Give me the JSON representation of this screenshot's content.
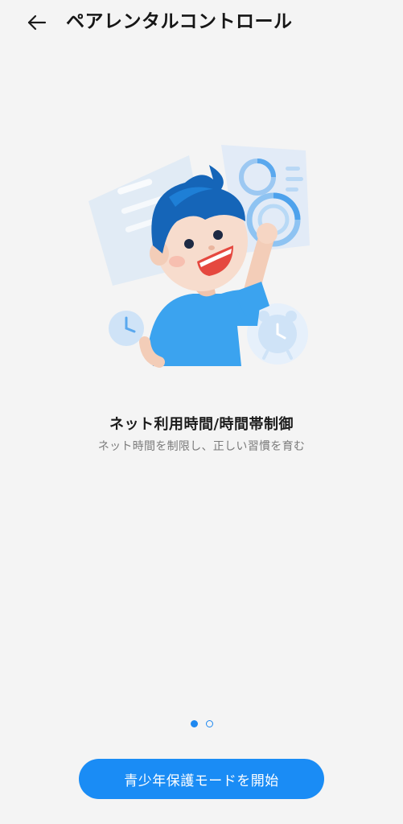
{
  "header": {
    "back_icon": "arrow-left-icon",
    "title": "ペアレンタルコントロール"
  },
  "illustration": {
    "subject": "boy-with-floating-screens",
    "icons": [
      "clock-icon",
      "alarm-clock-icon",
      "donut-chart-icon"
    ]
  },
  "feature": {
    "title": "ネット利用時間/時間帯制御",
    "description": "ネット時間を制限し、正しい習慣を育む"
  },
  "pager": {
    "count": 2,
    "active_index": 0
  },
  "actions": {
    "start_label": "青少年保護モードを開始"
  },
  "colors": {
    "background": "#f4f4f4",
    "accent": "#1a8cf5",
    "text_primary": "#1b1b1b",
    "text_secondary": "#7a7a7a"
  }
}
